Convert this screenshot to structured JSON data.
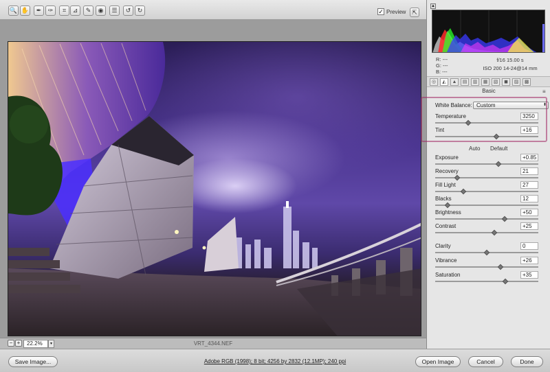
{
  "toolbar": {
    "tools": [
      {
        "name": "zoom-tool-icon",
        "glyph": "🔍"
      },
      {
        "name": "hand-tool-icon",
        "glyph": "✋"
      },
      {
        "name": "white-balance-tool-icon",
        "glyph": "✒"
      },
      {
        "name": "color-sampler-tool-icon",
        "glyph": "✑"
      },
      {
        "name": "crop-tool-icon",
        "glyph": "⌗"
      },
      {
        "name": "straighten-tool-icon",
        "glyph": "⊿"
      },
      {
        "name": "retouch-tool-icon",
        "glyph": "✎"
      },
      {
        "name": "red-eye-tool-icon",
        "glyph": "◉"
      },
      {
        "name": "preferences-icon",
        "glyph": "☰"
      },
      {
        "name": "rotate-left-icon",
        "glyph": "↺"
      },
      {
        "name": "rotate-right-icon",
        "glyph": "↻"
      }
    ],
    "preview_label": "Preview",
    "preview_checked": "✓",
    "fullscreen_glyph": "⇱"
  },
  "status": {
    "zoom_out": "−",
    "zoom_in": "+",
    "zoom_value": "22.2%",
    "zoom_arrow": "▾",
    "filename": "VRT_4344.NEF"
  },
  "readout": {
    "r": "R:   ---",
    "g": "G:   ---",
    "b": "B:   ---",
    "exposure": "f/16    15.00 s",
    "lens": "ISO 200    14-24@14 mm"
  },
  "panel": {
    "tabs": [
      "◎",
      "◭",
      "▲",
      "▤",
      "▥",
      "▦",
      "▧",
      "◼",
      "▨",
      "▩"
    ],
    "title": "Basic",
    "menu_glyph": "≡",
    "white_balance_label": "White Balance:",
    "white_balance_value": "Custom",
    "select_arrow": "⬍",
    "auto_label": "Auto",
    "default_label": "Default",
    "sliders": [
      {
        "id": "temperature",
        "label": "Temperature",
        "value": "3250",
        "position": 0.32
      },
      {
        "id": "tint",
        "label": "Tint",
        "value": "+16",
        "position": 0.59
      },
      {
        "id": "exposure",
        "label": "Exposure",
        "value": "+0.85",
        "position": 0.61
      },
      {
        "id": "recovery",
        "label": "Recovery",
        "value": "21",
        "position": 0.21
      },
      {
        "id": "fill-light",
        "label": "Fill Light",
        "value": "27",
        "position": 0.27
      },
      {
        "id": "blacks",
        "label": "Blacks",
        "value": "12",
        "position": 0.12
      },
      {
        "id": "brightness",
        "label": "Brightness",
        "value": "+50",
        "position": 0.67
      },
      {
        "id": "contrast",
        "label": "Contrast",
        "value": "+25",
        "position": 0.57
      },
      {
        "id": "clarity",
        "label": "Clarity",
        "value": "0",
        "position": 0.5
      },
      {
        "id": "vibrance",
        "label": "Vibrance",
        "value": "+26",
        "position": 0.63
      },
      {
        "id": "saturation",
        "label": "Saturation",
        "value": "+35",
        "position": 0.68
      }
    ]
  },
  "bottom": {
    "save_image": "Save Image...",
    "workflow": "Adobe RGB (1998); 8 bit; 4256 by 2832 (12.1MP); 240 ppi",
    "open_image": "Open Image",
    "cancel": "Cancel",
    "done": "Done"
  },
  "colors": {
    "annotation": "#a0286a",
    "sky": "#4b3590",
    "accent_light": "#7b3cff"
  }
}
